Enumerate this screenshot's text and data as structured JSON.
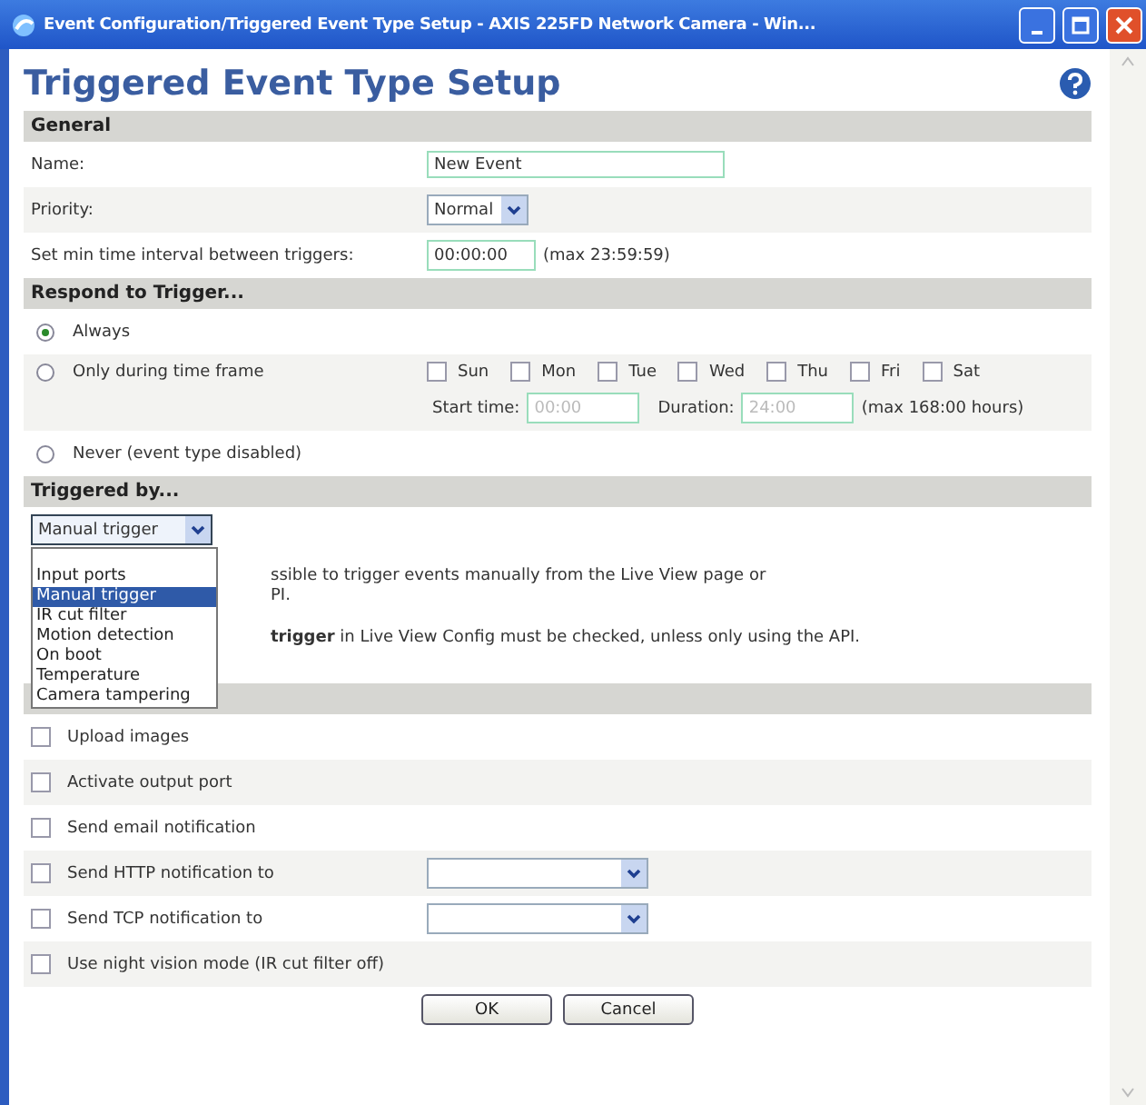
{
  "window": {
    "title": "Event Configuration/Triggered Event Type Setup - AXIS 225FD Network Camera - Win..."
  },
  "page": {
    "title": "Triggered Event Type Setup"
  },
  "general": {
    "header": "General",
    "name": {
      "label": "Name:",
      "value": "New Event"
    },
    "priority": {
      "label": "Priority:",
      "value": "Normal"
    },
    "interval": {
      "label": "Set min time interval between triggers:",
      "value": "00:00:00",
      "hint": "(max 23:59:59)"
    }
  },
  "respond": {
    "header": "Respond to Trigger...",
    "options": [
      {
        "kind": "plain",
        "label": "Always",
        "selected": true
      },
      {
        "kind": "timeframe",
        "label": "Only during time frame",
        "selected": false,
        "days": [
          {
            "label": "Sun",
            "checked": false
          },
          {
            "label": "Mon",
            "checked": false
          },
          {
            "label": "Tue",
            "checked": false
          },
          {
            "label": "Wed",
            "checked": false
          },
          {
            "label": "Thu",
            "checked": false
          },
          {
            "label": "Fri",
            "checked": false
          },
          {
            "label": "Sat",
            "checked": false
          }
        ],
        "start_time": {
          "label": "Start time:",
          "value": "00:00",
          "disabled": true
        },
        "duration": {
          "label": "Duration:",
          "value": "24:00",
          "disabled": true
        },
        "hint": "(max 168:00 hours)"
      },
      {
        "kind": "plain",
        "label": "Never (event type disabled)",
        "selected": false
      }
    ]
  },
  "triggered": {
    "header": "Triggered by...",
    "select": {
      "value": "Manual trigger",
      "expanded": true,
      "options": [
        {
          "label": "Input ports",
          "selected": false
        },
        {
          "label": "Manual trigger",
          "selected": true
        },
        {
          "label": "IR cut filter",
          "selected": false
        },
        {
          "label": "Motion detection",
          "selected": false
        },
        {
          "label": "On boot",
          "selected": false
        },
        {
          "label": "Temperature",
          "selected": false
        },
        {
          "label": "Camera tampering",
          "selected": false
        }
      ]
    },
    "note_lines": [
      "ssible to trigger events manually from the Live View page or",
      "PI.",
      "**trigger** in Live View Config must be checked, unless only using the API."
    ]
  },
  "actions": {
    "items": [
      {
        "kind": "checkbox",
        "label": "Upload images",
        "checked": false
      },
      {
        "kind": "checkbox",
        "label": "Activate output port",
        "checked": false
      },
      {
        "kind": "checkbox",
        "label": "Send email notification",
        "checked": false
      },
      {
        "kind": "checkbox_select",
        "label": "Send HTTP notification to",
        "checked": false
      },
      {
        "kind": "checkbox_select",
        "label": "Send TCP notification to",
        "checked": false
      },
      {
        "kind": "checkbox",
        "label": "Use night vision mode (IR cut filter off)",
        "checked": false
      }
    ]
  },
  "buttons": [
    "OK",
    "Cancel"
  ]
}
